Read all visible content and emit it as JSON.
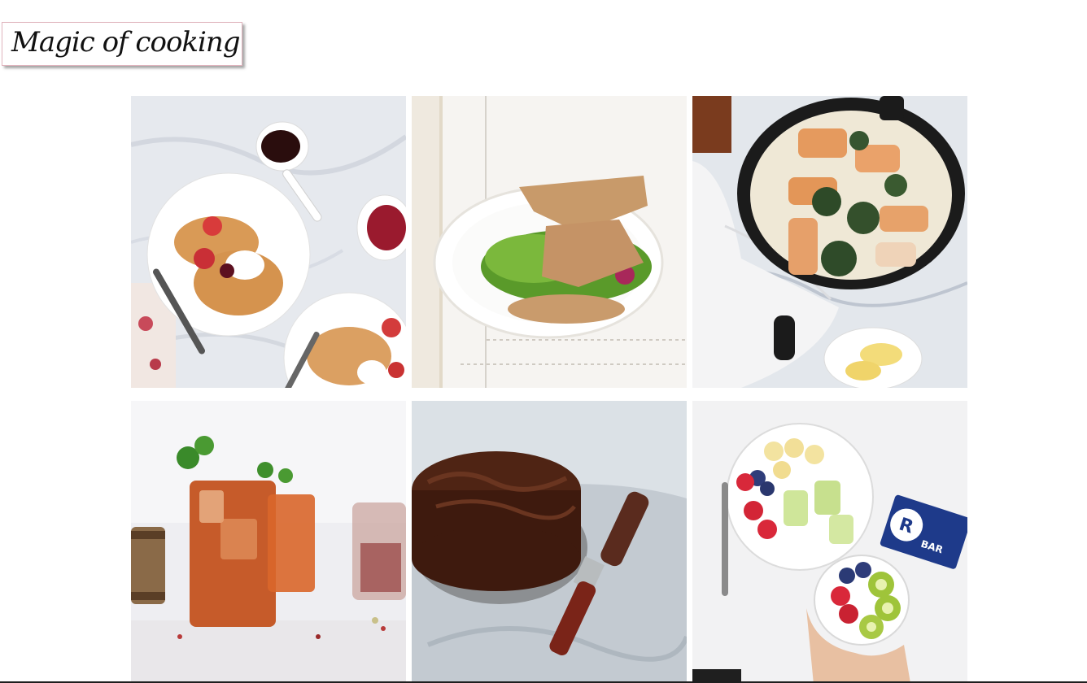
{
  "header": {
    "logo_text": "Magic of cooking"
  },
  "gallery": {
    "items": [
      {
        "name": "pancakes-with-strawberries",
        "icon": "photo-icon"
      },
      {
        "name": "buckwheat-crepe-salad",
        "icon": "photo-icon"
      },
      {
        "name": "salmon-skillet-spinach",
        "icon": "photo-icon"
      },
      {
        "name": "iced-tea-drinks",
        "icon": "photo-icon"
      },
      {
        "name": "chocolate-cake",
        "icon": "photo-icon"
      },
      {
        "name": "fruit-bowls",
        "icon": "photo-icon"
      }
    ]
  },
  "product_label": {
    "brand": "R",
    "word": "BAR"
  },
  "colors": {
    "logo_border": "#e0b4bd",
    "page_background": "#ffffff"
  }
}
